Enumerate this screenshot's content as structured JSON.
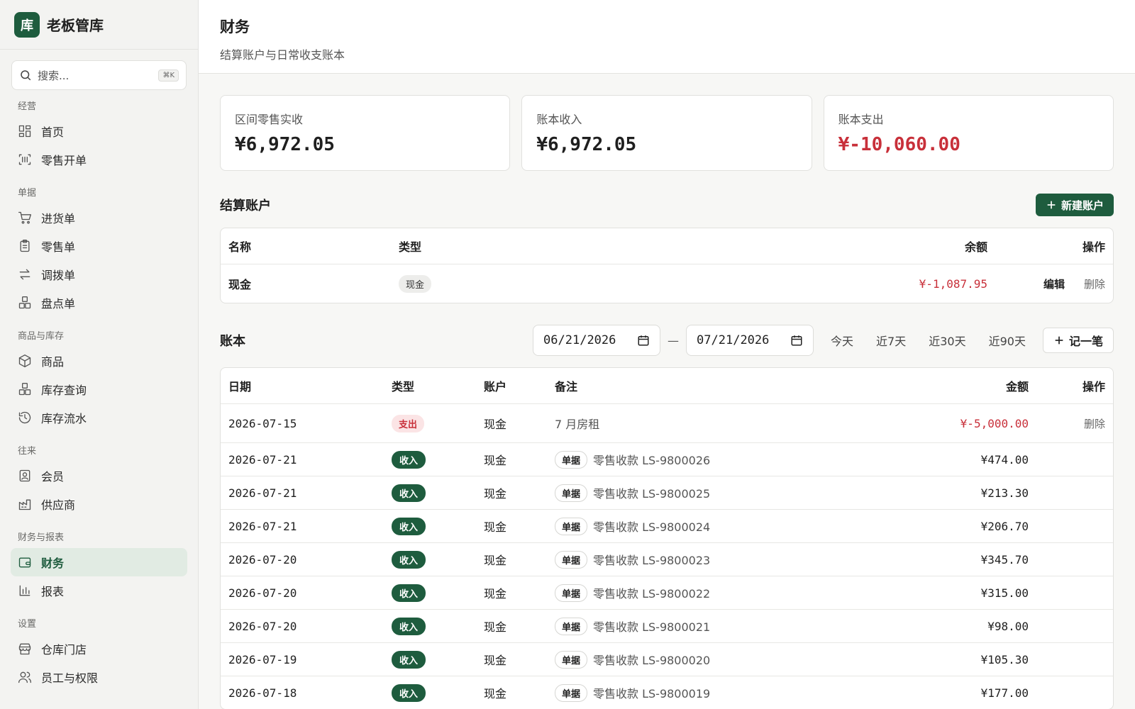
{
  "brand": {
    "logo": "库",
    "name": "老板管库"
  },
  "search": {
    "placeholder": "搜索...",
    "shortcut": "⌘K"
  },
  "nav": {
    "groups": [
      {
        "title": "经营",
        "items": [
          {
            "label": "首页",
            "icon": "dashboard-icon"
          },
          {
            "label": "零售开单",
            "icon": "scan-icon"
          }
        ]
      },
      {
        "title": "单据",
        "items": [
          {
            "label": "进货单",
            "icon": "cart-icon"
          },
          {
            "label": "零售单",
            "icon": "clipboard-icon"
          },
          {
            "label": "调拨单",
            "icon": "transfer-icon"
          },
          {
            "label": "盘点单",
            "icon": "boxes-icon"
          }
        ]
      },
      {
        "title": "商品与库存",
        "items": [
          {
            "label": "商品",
            "icon": "package-icon"
          },
          {
            "label": "库存查询",
            "icon": "boxes-icon"
          },
          {
            "label": "库存流水",
            "icon": "history-icon"
          }
        ]
      },
      {
        "title": "往来",
        "items": [
          {
            "label": "会员",
            "icon": "member-card-icon"
          },
          {
            "label": "供应商",
            "icon": "factory-icon"
          }
        ]
      },
      {
        "title": "财务与报表",
        "items": [
          {
            "label": "财务",
            "icon": "wallet-icon",
            "active": true
          },
          {
            "label": "报表",
            "icon": "bar-chart-icon"
          }
        ]
      },
      {
        "title": "设置",
        "items": [
          {
            "label": "仓库门店",
            "icon": "store-icon"
          },
          {
            "label": "员工与权限",
            "icon": "users-icon"
          }
        ]
      }
    ]
  },
  "header": {
    "title": "财务",
    "subtitle": "结算账户与日常收支账本"
  },
  "stats": [
    {
      "label": "区间零售实收",
      "value": "¥6,972.05",
      "negative": false
    },
    {
      "label": "账本收入",
      "value": "¥6,972.05",
      "negative": false
    },
    {
      "label": "账本支出",
      "value": "¥-10,060.00",
      "negative": true
    }
  ],
  "accounts": {
    "title": "结算账户",
    "new_button": "新建账户",
    "columns": {
      "name": "名称",
      "type": "类型",
      "balance": "余额",
      "ops": "操作"
    },
    "rows": [
      {
        "name": "现金",
        "type": "现金",
        "balance": "¥-1,087.95",
        "edit": "编辑",
        "delete": "删除"
      }
    ]
  },
  "ledger": {
    "title": "账本",
    "date_from": "06/21/2026",
    "date_to": "07/21/2026",
    "separator": "—",
    "quick_ranges": [
      "今天",
      "近7天",
      "近30天",
      "近90天"
    ],
    "add_button": "记一笔",
    "columns": {
      "date": "日期",
      "type": "类型",
      "account": "账户",
      "note": "备注",
      "amount": "金额",
      "ops": "操作"
    },
    "doc_tag": "单据",
    "rows": [
      {
        "date": "2026-07-15",
        "type": "支出",
        "kind": "expense",
        "account": "现金",
        "note": "7 月房租",
        "doc": false,
        "amount": "¥-5,000.00",
        "op": "删除"
      },
      {
        "date": "2026-07-21",
        "type": "收入",
        "kind": "income",
        "account": "现金",
        "note": "零售收款 LS-9800026",
        "doc": true,
        "amount": "¥474.00",
        "op": ""
      },
      {
        "date": "2026-07-21",
        "type": "收入",
        "kind": "income",
        "account": "现金",
        "note": "零售收款 LS-9800025",
        "doc": true,
        "amount": "¥213.30",
        "op": ""
      },
      {
        "date": "2026-07-21",
        "type": "收入",
        "kind": "income",
        "account": "现金",
        "note": "零售收款 LS-9800024",
        "doc": true,
        "amount": "¥206.70",
        "op": ""
      },
      {
        "date": "2026-07-20",
        "type": "收入",
        "kind": "income",
        "account": "现金",
        "note": "零售收款 LS-9800023",
        "doc": true,
        "amount": "¥345.70",
        "op": ""
      },
      {
        "date": "2026-07-20",
        "type": "收入",
        "kind": "income",
        "account": "现金",
        "note": "零售收款 LS-9800022",
        "doc": true,
        "amount": "¥315.00",
        "op": ""
      },
      {
        "date": "2026-07-20",
        "type": "收入",
        "kind": "income",
        "account": "现金",
        "note": "零售收款 LS-9800021",
        "doc": true,
        "amount": "¥98.00",
        "op": ""
      },
      {
        "date": "2026-07-19",
        "type": "收入",
        "kind": "income",
        "account": "现金",
        "note": "零售收款 LS-9800020",
        "doc": true,
        "amount": "¥105.30",
        "op": ""
      },
      {
        "date": "2026-07-18",
        "type": "收入",
        "kind": "income",
        "account": "现金",
        "note": "零售收款 LS-9800019",
        "doc": true,
        "amount": "¥177.00",
        "op": ""
      }
    ]
  },
  "colors": {
    "brand": "#1e5c3e",
    "negative": "#c8303a",
    "active_nav_bg": "#e1ebe3"
  }
}
